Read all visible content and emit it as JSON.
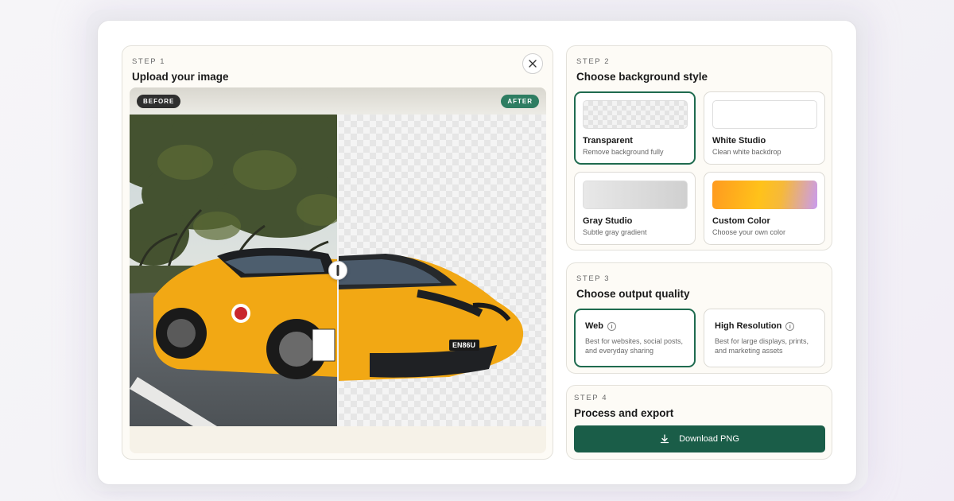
{
  "upload": {
    "step": "STEP 1",
    "title": "Upload your image",
    "before_badge": "BEFORE",
    "after_badge": "AFTER",
    "plate_text": "EN86U"
  },
  "background": {
    "step": "STEP 2",
    "title": "Choose background style",
    "options": [
      {
        "title": "Transparent",
        "subtitle": "Remove background fully",
        "selected": true
      },
      {
        "title": "White Studio",
        "subtitle": "Clean white backdrop",
        "selected": false
      },
      {
        "title": "Gray Studio",
        "subtitle": "Subtle gray gradient",
        "selected": false
      },
      {
        "title": "Custom Color",
        "subtitle": "Choose your own color",
        "selected": false
      }
    ]
  },
  "quality": {
    "step": "STEP 3",
    "title": "Choose output quality",
    "options": [
      {
        "title": "Web",
        "subtitle": "Best for websites, social posts, and everyday sharing",
        "selected": true
      },
      {
        "title": "High Resolution",
        "subtitle": "Best for large displays, prints, and marketing assets",
        "selected": false
      }
    ]
  },
  "export": {
    "step": "STEP 4",
    "title": "Process and export",
    "button_label": "Download PNG"
  },
  "colors": {
    "accent": "#1a5d48",
    "selected_border": "#1f6b4f",
    "after_badge": "#2e7d62",
    "car": "#f2a814"
  },
  "icons": {
    "close": "close-icon",
    "download": "download-icon",
    "info": "info-icon",
    "slider": "slider-handle-icon"
  }
}
